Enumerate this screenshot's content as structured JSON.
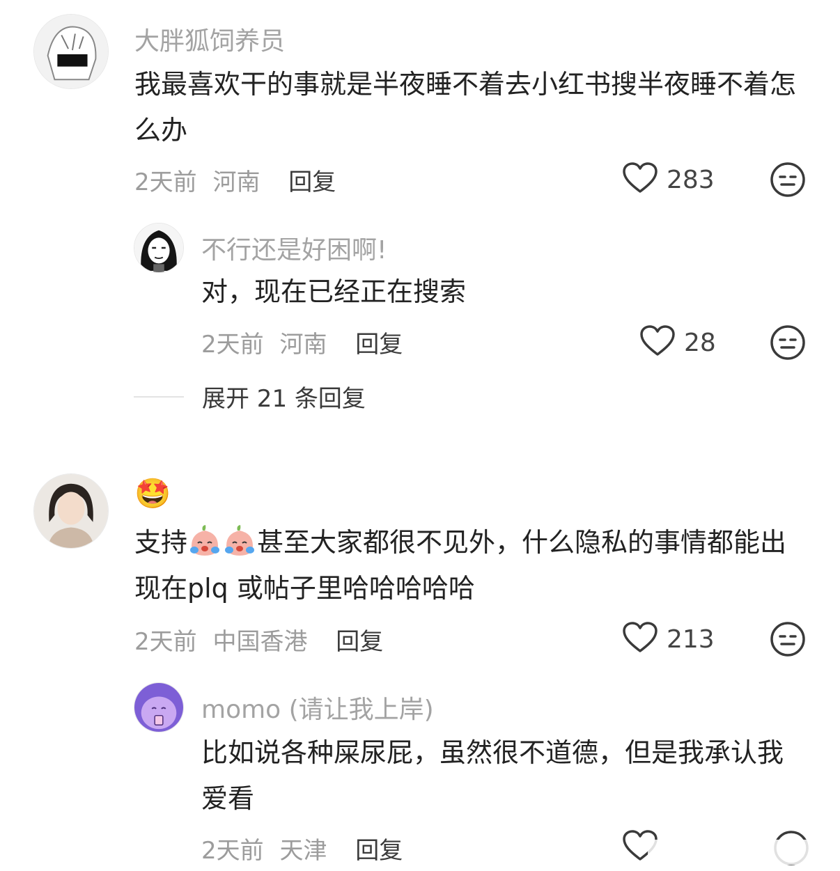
{
  "comments": [
    {
      "username": "大胖狐饲养员",
      "text": "我最喜欢干的事就是半夜睡不着去小红书搜半夜睡不着怎么办",
      "time": "2天前",
      "location": "河南",
      "reply_label": "回复",
      "likes": "283"
    },
    {
      "username": "不行还是好困啊!",
      "text": "对，现在已经正在搜索",
      "time": "2天前",
      "location": "河南",
      "reply_label": "回复",
      "likes": "28"
    },
    {
      "username": "🤩",
      "text_prefix": "支持",
      "text_suffix": "甚至大家都很不见外，什么隐私的事情都能出现在plq 或帖子里哈哈哈哈哈",
      "time": "2天前",
      "location": "中国香港",
      "reply_label": "回复",
      "likes": "213"
    },
    {
      "username": "momo (请让我上岸)",
      "text": "比如说各种屎尿屁，虽然很不道德，但是我承认我爱看",
      "time": "2天前",
      "location": "天津",
      "reply_label": "回复",
      "likes": ""
    }
  ],
  "expand_replies": "展开 21 条回复",
  "icons": {
    "like": "heart-outline-icon",
    "dislike": "neutral-face-icon",
    "emoji_inline": "crying-peach-emoji"
  }
}
